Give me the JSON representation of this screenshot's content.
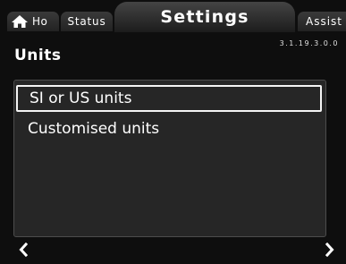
{
  "tabs": {
    "home": {
      "label": "Ho",
      "icon": "home-icon"
    },
    "status": {
      "label": "Status"
    },
    "settings": {
      "label": "Settings"
    },
    "assist": {
      "label": "Assist"
    }
  },
  "version": "3.1.19.3.0.0",
  "page_title": "Units",
  "list": {
    "items": [
      {
        "label": "SI or US units",
        "selected": true
      },
      {
        "label": "Customised units",
        "selected": false
      }
    ]
  },
  "nav": {
    "left_icon": "chevron-left-icon",
    "right_icon": "chevron-right-icon"
  },
  "colors": {
    "background": "#0e0e0e",
    "panel": "#262626",
    "text": "#ffffff",
    "selection_border": "#f4f4f4"
  }
}
